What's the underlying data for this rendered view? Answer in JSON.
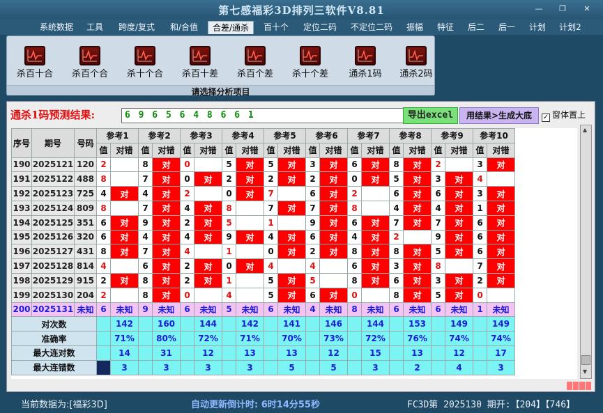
{
  "app": {
    "title": "第七感福彩3D排列三软件V8.81"
  },
  "menu": [
    "系统数据",
    "工具",
    "跨度/复式",
    "和/合值",
    "合差/通杀",
    "百十个",
    "定位二码",
    "不定位二码",
    "振幅",
    "特征",
    "后二",
    "后一",
    "计划",
    "计划2"
  ],
  "ribbon": {
    "buttons": [
      "杀百十合",
      "杀百个合",
      "杀十个合",
      "杀百十差",
      "杀百个差",
      "杀十个差",
      "通杀1码",
      "通杀2码"
    ],
    "caption": "请选择分析项目"
  },
  "result": {
    "label": "通杀1码预测结果:",
    "value": "6 9 6 5 6 4 8 6 6 1",
    "export_label": "导出excel",
    "generate_label": "用结果>生成大底",
    "topmost_label": "窗体置上"
  },
  "table": {
    "col_seq": "序号",
    "col_period": "期号",
    "col_number": "号码",
    "ref_headers": [
      "参考1",
      "参考2",
      "参考3",
      "参考4",
      "参考5",
      "参考6",
      "参考7",
      "参考8",
      "参考9",
      "参考10"
    ],
    "sub_value": "值",
    "sub_check": "对错",
    "hit_text": "对",
    "unknown_text": "未知",
    "rows": [
      {
        "seq": "190",
        "period": "2025121",
        "number": "120",
        "values": [
          "2",
          "8",
          "0",
          "5",
          "5",
          "3",
          "6",
          "8",
          "2",
          "3"
        ],
        "hits": [
          0,
          1,
          0,
          1,
          1,
          1,
          1,
          1,
          0,
          1
        ]
      },
      {
        "seq": "191",
        "period": "2025122",
        "number": "488",
        "values": [
          "8",
          "7",
          "0",
          "2",
          "2",
          "2",
          "0",
          "5",
          "3",
          "4"
        ],
        "hits": [
          0,
          1,
          1,
          1,
          1,
          1,
          1,
          1,
          1,
          0
        ]
      },
      {
        "seq": "192",
        "period": "2025123",
        "number": "725",
        "values": [
          "4",
          "4",
          "2",
          "0",
          "7",
          "6",
          "2",
          "6",
          "6",
          "3"
        ],
        "hits": [
          1,
          1,
          0,
          1,
          0,
          1,
          0,
          1,
          1,
          1
        ]
      },
      {
        "seq": "193",
        "period": "2025124",
        "number": "809",
        "values": [
          "8",
          "7",
          "4",
          "8",
          "7",
          "7",
          "8",
          "4",
          "4",
          "1"
        ],
        "hits": [
          0,
          1,
          1,
          0,
          1,
          1,
          0,
          1,
          1,
          1
        ]
      },
      {
        "seq": "194",
        "period": "2025125",
        "number": "351",
        "values": [
          "6",
          "9",
          "2",
          "5",
          "1",
          "9",
          "6",
          "7",
          "7",
          "6"
        ],
        "hits": [
          1,
          1,
          1,
          0,
          0,
          1,
          1,
          1,
          1,
          1
        ]
      },
      {
        "seq": "195",
        "period": "2025126",
        "number": "320",
        "values": [
          "6",
          "4",
          "4",
          "9",
          "4",
          "6",
          "4",
          "2",
          "9",
          "6"
        ],
        "hits": [
          1,
          1,
          1,
          1,
          1,
          1,
          1,
          0,
          1,
          1
        ]
      },
      {
        "seq": "196",
        "period": "2025127",
        "number": "431",
        "values": [
          "8",
          "7",
          "4",
          "1",
          "0",
          "2",
          "8",
          "8",
          "5",
          "6"
        ],
        "hits": [
          1,
          1,
          0,
          0,
          1,
          1,
          1,
          1,
          1,
          1
        ]
      },
      {
        "seq": "197",
        "period": "2025128",
        "number": "814",
        "values": [
          "4",
          "6",
          "2",
          "0",
          "4",
          "4",
          "6",
          "3",
          "8",
          "7"
        ],
        "hits": [
          0,
          1,
          1,
          1,
          0,
          0,
          1,
          1,
          0,
          1
        ]
      },
      {
        "seq": "198",
        "period": "2025129",
        "number": "915",
        "values": [
          "2",
          "8",
          "2",
          "1",
          "5",
          "5",
          "8",
          "6",
          "3",
          "2"
        ],
        "hits": [
          1,
          1,
          1,
          0,
          1,
          0,
          1,
          1,
          1,
          1
        ]
      },
      {
        "seq": "199",
        "period": "2025130",
        "number": "204",
        "values": [
          "2",
          "8",
          "0",
          "4",
          "5",
          "6",
          "0",
          "8",
          "5",
          "0"
        ],
        "hits": [
          0,
          1,
          0,
          0,
          1,
          1,
          0,
          1,
          1,
          0
        ]
      },
      {
        "seq": "200",
        "period": "2025131",
        "number": "未知",
        "values": [
          "6",
          "9",
          "6",
          "5",
          "6",
          "4",
          "8",
          "6",
          "6",
          "1"
        ],
        "hits": null
      }
    ],
    "summary": [
      {
        "label": "对次数",
        "values": [
          "142",
          "160",
          "144",
          "142",
          "141",
          "146",
          "144",
          "153",
          "149",
          "149"
        ]
      },
      {
        "label": "准确率",
        "values": [
          "71%",
          "80%",
          "72%",
          "71%",
          "70%",
          "73%",
          "72%",
          "76%",
          "74%",
          "74%"
        ]
      },
      {
        "label": "最大连对数",
        "values": [
          "14",
          "31",
          "12",
          "13",
          "13",
          "12",
          "15",
          "13",
          "12",
          "17"
        ]
      },
      {
        "label": "最大连错数",
        "values": [
          "3",
          "3",
          "3",
          "3",
          "5",
          "5",
          "3",
          "2",
          "4",
          "3"
        ]
      }
    ]
  },
  "status": {
    "current_data": "当前数据为:[福彩3D]",
    "countdown": "自动更新倒计时: 6时14分55秒",
    "period_info": "FC3D第 2025130 期开:【204】【746】"
  },
  "colors": {
    "hit": "#ff0000",
    "unknown_row": "#f3c4f3",
    "summary": "#7cf4f4",
    "accent_red": "#e01010",
    "accent_green": "#0a8a0a"
  }
}
